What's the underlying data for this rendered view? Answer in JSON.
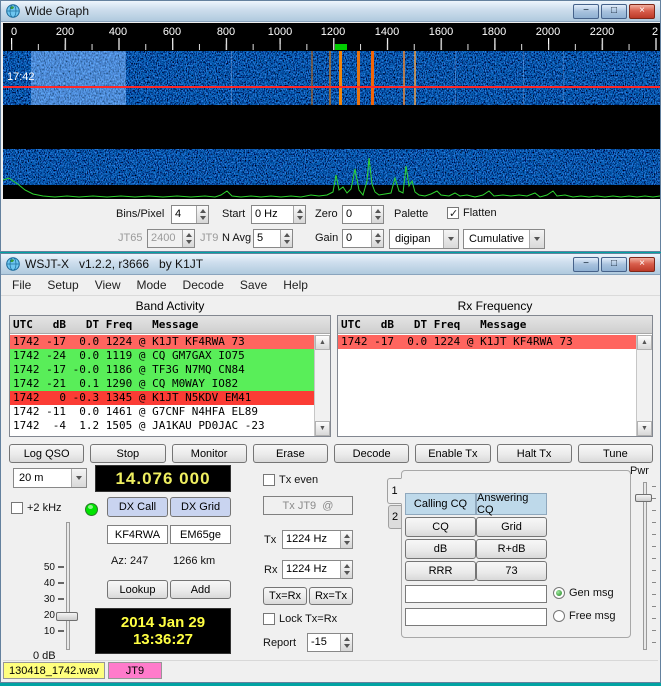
{
  "colors": {
    "decode_red": "#ff655f",
    "decode_red_strong": "#fb3c35",
    "decode_green": "#59ee59",
    "led_green": "#00e400",
    "freq_display_text": "#efef60",
    "clock_text": "#ffff42",
    "wav_label_bg": "#ffff7e",
    "mode_label_bg": "#ff7bcb",
    "dx_button_bg": "#c9d4f0",
    "cq_header_bg": "#bed9ea",
    "marker_green": "#00cc00",
    "waterfall_line_red": "#ff2727"
  },
  "icons": {
    "minimize": "−",
    "maximize": "□",
    "close": "×",
    "scroll_up": "▲",
    "scroll_down": "▼"
  },
  "wide_graph": {
    "title": "Wide Graph",
    "time_marker": "17:42",
    "freq_ticks": [
      "0",
      "200",
      "400",
      "600",
      "800",
      "1000",
      "1200",
      "1400",
      "1600",
      "1800",
      "2000",
      "2200",
      "2"
    ],
    "controls": {
      "bins_label": "Bins/Pixel",
      "bins_value": "4",
      "start_label": "Start",
      "start_value": "0 Hz",
      "zero_label": "Zero",
      "zero_value": "0",
      "palette_label": "Palette",
      "flatten_label": "Flatten",
      "jt65_label": "JT65",
      "split_value": "2400",
      "jt9_label": "JT9",
      "navg_label": "N Avg",
      "navg_value": "5",
      "gain_label": "Gain",
      "gain_value": "0",
      "palette_value": "digipan",
      "spec_mode_value": "Cumulative"
    }
  },
  "main": {
    "title": "WSJT-X   v1.2.2, r3666   by K1JT",
    "menu": [
      "File",
      "Setup",
      "View",
      "Mode",
      "Decode",
      "Save",
      "Help"
    ],
    "decode_header": "UTC   dB   DT Freq   Message",
    "band_activity": {
      "title": "Band Activity",
      "rows": [
        {
          "text": "1742 -17  0.0 1224 @ K1JT KF4RWA 73",
          "highlight": "red"
        },
        {
          "text": "1742 -24  0.0 1119 @ CQ GM7GAX IO75",
          "highlight": "green"
        },
        {
          "text": "1742 -17 -0.0 1186 @ TF3G N7MQ CN84",
          "highlight": "green"
        },
        {
          "text": "1742 -21  0.1 1290 @ CQ M0WAY IO82",
          "highlight": "green"
        },
        {
          "text": "1742   0 -0.3 1345 @ K1JT N5KDV EM41",
          "highlight": "red_strong"
        },
        {
          "text": "1742 -11  0.0 1461 @ G7CNF N4HFA EL89",
          "highlight": "none"
        },
        {
          "text": "1742  -4  1.2 1505 @ JA1KAU PD0JAC -23",
          "highlight": "none"
        }
      ]
    },
    "rx_frequency": {
      "title": "Rx Frequency",
      "rows": [
        {
          "text": "1742 -17  0.0 1224 @ K1JT KF4RWA 73",
          "highlight": "red"
        }
      ]
    },
    "buttons": [
      "Log QSO",
      "Stop",
      "Monitor",
      "Erase",
      "Decode",
      "Enable Tx",
      "Halt Tx",
      "Tune"
    ],
    "band_select": "20 m",
    "frequency": "14.076 000",
    "plus2khz_label": "+2 kHz",
    "dx_call_label": "DX Call",
    "dx_grid_label": "DX Grid",
    "dx_call_value": "KF4RWA",
    "dx_grid_value": "EM65ge",
    "azimuth": "Az: 247",
    "distance": "1266 km",
    "lookup_label": "Lookup",
    "add_label": "Add",
    "date": "2014 Jan 29",
    "time": "13:36:27",
    "db_scale": [
      "50",
      "40",
      "30",
      "20",
      "10"
    ],
    "db_zero_label": "0 dB",
    "tx_even_label": "Tx even",
    "tx_jt9_label": "Tx JT9  @",
    "tx_label": "Tx",
    "tx_freq": "1224 Hz",
    "rx_label": "Rx",
    "rx_freq": "1224 Hz",
    "tx_eq_rx": "Tx=Rx",
    "rx_eq_tx": "Rx=Tx",
    "lock_label": "Lock Tx=Rx",
    "report_label": "Report",
    "report_value": "-15",
    "tabs": [
      "1",
      "2"
    ],
    "calling_cq": "Calling CQ",
    "answering_cq": "Answering CQ",
    "msg_buttons": [
      [
        "CQ",
        "Grid"
      ],
      [
        "dB",
        "R+dB"
      ],
      [
        "RRR",
        "73"
      ]
    ],
    "gen_msg_label": "Gen msg",
    "free_msg_label": "Free msg",
    "gen_msg_value": "",
    "free_msg_value": "",
    "pwr_label": "Pwr",
    "status_wav": "130418_1742.wav",
    "status_mode": "JT9"
  }
}
